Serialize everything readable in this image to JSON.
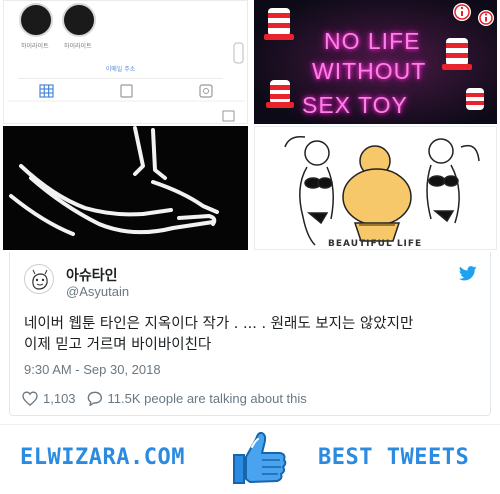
{
  "images": {
    "profile_screenshot": {
      "usernames": [
        "하이라이트",
        "하이라이트"
      ],
      "email_placeholder": "이메일 주소"
    },
    "neon_sign": {
      "lines": [
        "NO LIFE",
        "WITHOUT",
        "SEX TOY"
      ]
    },
    "beach_cartoon": {
      "caption": "BEAUTIFUL LIFE"
    }
  },
  "tweet": {
    "display_name": "아슈타인",
    "handle": "@Asyutain",
    "text_line1": "네이버 웹툰 타인은 지옥이다 작가 . ... . 원래도 보지는 않았지만",
    "text_line2": "이제 믿고 거르며 바이바이친다",
    "timestamp": "9:30 AM - Sep 30, 2018",
    "likes": "1,103",
    "talking": "11.5K people are talking about this",
    "icons": {
      "brand": "twitter-bird-icon",
      "like": "heart-icon",
      "reply": "speech-bubble-icon"
    },
    "colors": {
      "brand": "#1da1f2",
      "text": "#1c2022",
      "meta": "#697882"
    }
  },
  "banner": {
    "left_text": "ELWIZARA.COM",
    "right_text": "BEST TWEETS",
    "icon": "thumbs-up-icon",
    "color": "#2b8be0"
  }
}
